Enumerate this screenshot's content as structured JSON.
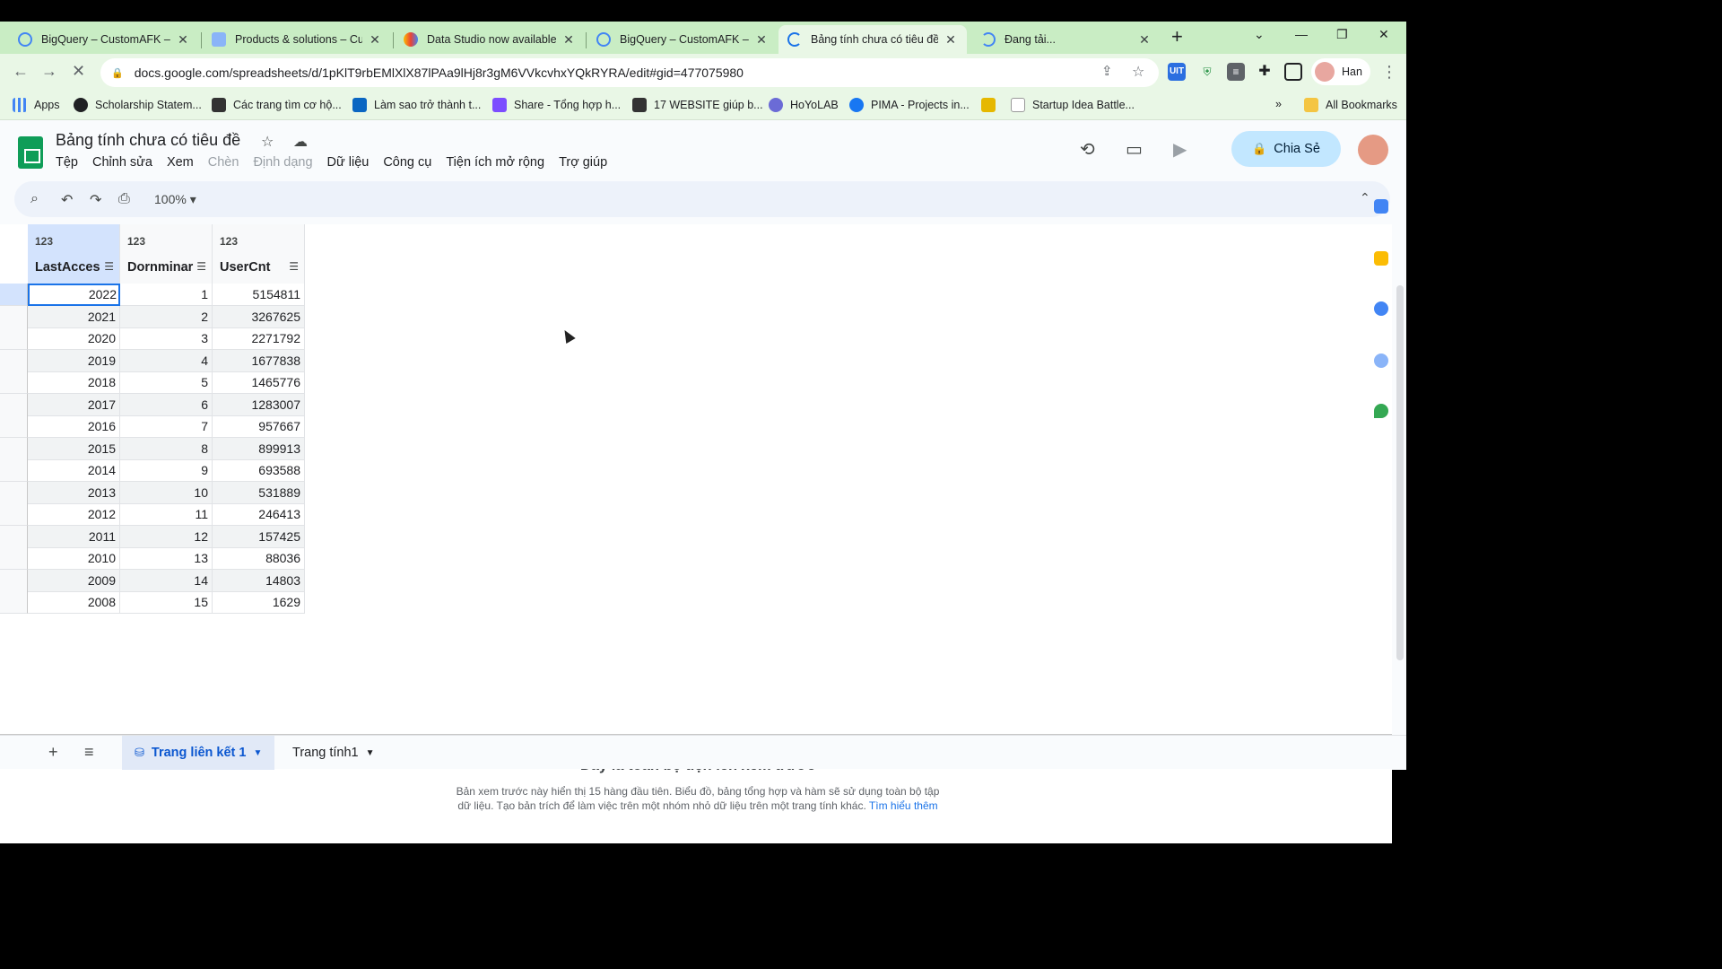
{
  "browser": {
    "tabs": [
      {
        "title": "BigQuery – CustomAFK – C",
        "icon": "bigquery-icon",
        "color": "#4285f4"
      },
      {
        "title": "Products & solutions – Cus",
        "icon": "gcp-icon",
        "color": "#4285f4"
      },
      {
        "title": "Data Studio now available",
        "icon": "data-studio-icon",
        "color": "#fbbc04"
      },
      {
        "title": "BigQuery – CustomAFK – C",
        "icon": "bigquery-icon",
        "color": "#4285f4"
      },
      {
        "title": "Bảng tính chưa có tiêu đề",
        "icon": "loading-icon",
        "color": "#34a853"
      },
      {
        "title": "Đang tải...",
        "icon": "loading-icon",
        "color": "#4285f4"
      }
    ],
    "url": "docs.google.com/spreadsheets/d/1pKlT9rbEMlXlX87lPAa9lHj8r3gM6VVkcvhxYQkRYRA/edit#gid=477075980",
    "profile_name": "Han",
    "bookmarks": [
      {
        "label": "Apps",
        "color": "#4285f4"
      },
      {
        "label": "Scholarship Statem...",
        "color": "#202124"
      },
      {
        "label": "Các trang tìm cơ hộ...",
        "color": "#333333"
      },
      {
        "label": "Làm sao trở thành t...",
        "color": "#0a66c2"
      },
      {
        "label": "Share - Tổng hợp h...",
        "color": "#7c4dff"
      },
      {
        "label": "17 WEBSITE giúp b...",
        "color": "#333333"
      },
      {
        "label": "HoYoLAB",
        "color": "#6b6bd6"
      },
      {
        "label": "PIMA - Projects in...",
        "color": "#1877f2"
      },
      {
        "label": "",
        "color": "#e6b800"
      },
      {
        "label": "Startup Idea Battle...",
        "color": "#ffffff"
      }
    ],
    "more_bookmarks": "»",
    "all_bookmarks": "All Bookmarks"
  },
  "sheets": {
    "doc_title": "Bảng tính chưa có tiêu đề",
    "menus": [
      "Tệp",
      "Chỉnh sửa",
      "Xem",
      "Chèn",
      "Định dạng",
      "Dữ liệu",
      "Công cụ",
      "Tiện ích mở rộng",
      "Trợ giúp"
    ],
    "disabled_menus": [
      "Chèn",
      "Định dạng"
    ],
    "share_label": "Chia Sẻ",
    "zoom": "100%",
    "columns": [
      {
        "type": "123",
        "name": "LastAcces"
      },
      {
        "type": "123",
        "name": "Dornminar"
      },
      {
        "type": "123",
        "name": "UserCnt"
      }
    ],
    "rows": [
      [
        "2022",
        "1",
        "5154811"
      ],
      [
        "2021",
        "2",
        "3267625"
      ],
      [
        "2020",
        "3",
        "2271792"
      ],
      [
        "2019",
        "4",
        "1677838"
      ],
      [
        "2018",
        "5",
        "1465776"
      ],
      [
        "2017",
        "6",
        "1283007"
      ],
      [
        "2016",
        "7",
        "957667"
      ],
      [
        "2015",
        "8",
        "899913"
      ],
      [
        "2014",
        "9",
        "693588"
      ],
      [
        "2013",
        "10",
        "531889"
      ],
      [
        "2012",
        "11",
        "246413"
      ],
      [
        "2011",
        "12",
        "157425"
      ],
      [
        "2010",
        "13",
        "88036"
      ],
      [
        "2009",
        "14",
        "14803"
      ],
      [
        "2008",
        "15",
        "1629"
      ]
    ],
    "preview_title": "Đây là toàn bộ tiện ích xem trước",
    "preview_body": "Bản xem trước này hiển thị 15 hàng đầu tiên. Biểu đồ, bảng tổng hợp và hàm sẽ sử dụng toàn bộ tập dữ liệu. Tạo bản trích để làm việc trên một nhóm nhỏ dữ liệu trên một trang tính khác.",
    "preview_link": "Tìm hiểu thêm",
    "sheet_tabs": [
      "Trang liên kết 1",
      "Trang tính1"
    ]
  }
}
